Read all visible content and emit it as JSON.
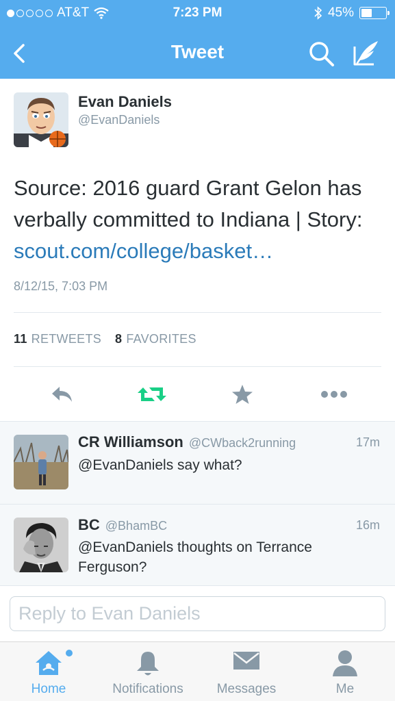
{
  "status_bar": {
    "carrier": "AT&T",
    "time": "7:23 PM",
    "battery": "45%",
    "battery_level": 0.45,
    "signal_bars": 1,
    "icons": [
      "wifi-icon",
      "bluetooth-icon",
      "battery-icon"
    ]
  },
  "nav": {
    "title": "Tweet",
    "icons": [
      "back-chevron-icon",
      "search-icon",
      "compose-icon"
    ]
  },
  "tweet": {
    "author_name": "Evan Daniels",
    "author_handle": "@EvanDaniels",
    "text": "Source: 2016 guard Grant Gelon has verbally committed to Indiana | Story: ",
    "link_text": "scout.com/college/basket…",
    "timestamp": "8/12/15, 7:03 PM",
    "retweets_count": "11",
    "retweets_label": "RETWEETS",
    "favorites_count": "8",
    "favorites_label": "FAVORITES",
    "actions": [
      "reply-icon",
      "retweet-icon",
      "favorite-star-icon",
      "more-dots-icon"
    ],
    "colors": {
      "retweet_active": "#19cf86",
      "action_gray": "#8899a6",
      "link": "#2b7bb9"
    }
  },
  "replies": [
    {
      "name": "CR Williamson",
      "handle": "@CWback2running",
      "time": "17m",
      "text": "@EvanDaniels say what?"
    },
    {
      "name": "BC",
      "handle": "@BhamBC",
      "time": "16m",
      "text": "@EvanDaniels thoughts on Terrance Ferguson?"
    }
  ],
  "composer": {
    "placeholder": "Reply to Evan Daniels"
  },
  "tabbar": {
    "tabs": [
      {
        "label": "Home",
        "icon": "home-icon",
        "active": true
      },
      {
        "label": "Notifications",
        "icon": "bell-icon",
        "active": false
      },
      {
        "label": "Messages",
        "icon": "envelope-icon",
        "active": false
      },
      {
        "label": "Me",
        "icon": "person-icon",
        "active": false
      }
    ]
  },
  "colors": {
    "brand_blue": "#55acee",
    "text_dark": "#292f33",
    "text_gray": "#8899a6"
  }
}
